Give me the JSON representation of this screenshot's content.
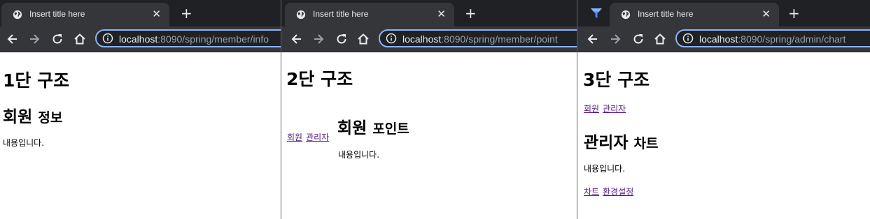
{
  "windows": [
    {
      "tab_title": "Insert title here",
      "url_host": "localhost",
      "url_path": ":8090/spring/member/info",
      "page_title": "1단 구조",
      "section_title": "회원",
      "section_sub": "정보",
      "body_text": "내용입니다."
    },
    {
      "tab_title": "Insert title here",
      "url_host": "localhost",
      "url_path": ":8090/spring/member/point",
      "page_title": "2단 구조",
      "menu_links": [
        "회원",
        "관리자"
      ],
      "section_title": "회원",
      "section_sub": "포인트",
      "body_text": "내용입니다."
    },
    {
      "tab_title": "Insert title here",
      "url_host": "localhost",
      "url_path": ":8090/spring/admin/chart",
      "page_title": "3단 구조",
      "menu_links": [
        "회원",
        "관리자"
      ],
      "section_title": "관리자",
      "section_sub": "차트",
      "body_text": "내용입니다.",
      "sub_links": [
        "차트",
        "환경설정"
      ]
    }
  ],
  "icons": {
    "tab_favicon": "globe-icon",
    "pinned_extension": "funnel-icon",
    "back": "arrow-left-icon",
    "forward": "arrow-right-icon",
    "reload": "reload-icon",
    "home": "home-icon",
    "site_info": "info-icon",
    "close": "close-icon",
    "new_tab": "plus-icon"
  },
  "colors": {
    "tabstrip": "#202124",
    "tab_active": "#35363a",
    "omnibox_focus": "#8ab4f8",
    "link_visited": "#551a8b"
  }
}
